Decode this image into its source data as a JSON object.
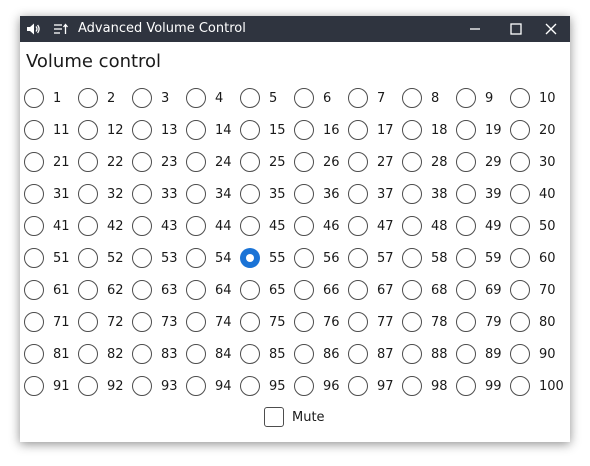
{
  "window": {
    "title": "Advanced Volume Control",
    "app_icon": "speaker-icon",
    "menu_icon": "menu-icon"
  },
  "heading": "Volume control",
  "volume": {
    "options": [
      "1",
      "2",
      "3",
      "4",
      "5",
      "6",
      "7",
      "8",
      "9",
      "10",
      "11",
      "12",
      "13",
      "14",
      "15",
      "16",
      "17",
      "18",
      "19",
      "20",
      "21",
      "22",
      "23",
      "24",
      "25",
      "26",
      "27",
      "28",
      "29",
      "30",
      "31",
      "32",
      "33",
      "34",
      "35",
      "36",
      "37",
      "38",
      "39",
      "40",
      "41",
      "42",
      "43",
      "44",
      "45",
      "46",
      "47",
      "48",
      "49",
      "50",
      "51",
      "52",
      "53",
      "54",
      "55",
      "56",
      "57",
      "58",
      "59",
      "60",
      "61",
      "62",
      "63",
      "64",
      "65",
      "66",
      "67",
      "68",
      "69",
      "70",
      "71",
      "72",
      "73",
      "74",
      "75",
      "76",
      "77",
      "78",
      "79",
      "80",
      "81",
      "82",
      "83",
      "84",
      "85",
      "86",
      "87",
      "88",
      "89",
      "90",
      "91",
      "92",
      "93",
      "94",
      "95",
      "96",
      "97",
      "98",
      "99",
      "100"
    ],
    "selected": "55"
  },
  "mute": {
    "label": "Mute",
    "checked": false
  },
  "colors": {
    "titlebar": "#2f343f",
    "accent": "#1a73d6"
  }
}
